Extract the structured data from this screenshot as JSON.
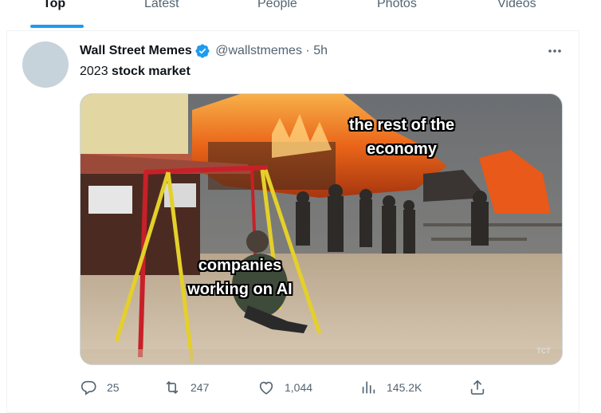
{
  "tabs": [
    {
      "label": "Top",
      "active": true
    },
    {
      "label": "Latest",
      "active": false
    },
    {
      "label": "People",
      "active": false
    },
    {
      "label": "Photos",
      "active": false
    },
    {
      "label": "Videos",
      "active": false
    }
  ],
  "tweet": {
    "author_name": "Wall Street Memes",
    "handle": "@wallstmemes",
    "separator": "·",
    "time": "5h",
    "text_plain": "2023 ",
    "text_bold": "stock market",
    "media": {
      "caption_top": "the rest of the economy",
      "caption_bottom": "companies working on AI",
      "watermark": "TCT"
    },
    "actions": {
      "replies": "25",
      "retweets": "247",
      "likes": "1,044",
      "views": "145.2K"
    }
  },
  "colors": {
    "accent": "#1d9bf0",
    "secondary_text": "#536471",
    "avatar_placeholder": "#c7d3da"
  },
  "icons": [
    "verified-badge-icon",
    "more-icon",
    "reply-icon",
    "retweet-icon",
    "like-icon",
    "views-icon",
    "share-icon"
  ]
}
